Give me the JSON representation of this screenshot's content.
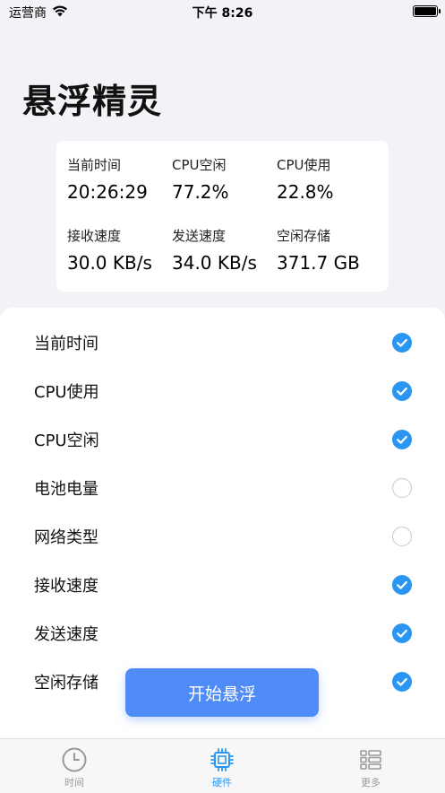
{
  "status_bar": {
    "carrier": "运营商",
    "time": "下午 8:26"
  },
  "page_title": "悬浮精灵",
  "stats": [
    {
      "label": "当前时间",
      "value": "20:26:29"
    },
    {
      "label": "CPU空闲",
      "value": "77.2%"
    },
    {
      "label": "CPU使用",
      "value": "22.8%"
    },
    {
      "label": "接收速度",
      "value": "30.0 KB/s"
    },
    {
      "label": "发送速度",
      "value": "34.0 KB/s"
    },
    {
      "label": "空闲存储",
      "value": "371.7 GB"
    }
  ],
  "options": [
    {
      "label": "当前时间",
      "checked": true
    },
    {
      "label": "CPU使用",
      "checked": true
    },
    {
      "label": "CPU空闲",
      "checked": true
    },
    {
      "label": "电池电量",
      "checked": false
    },
    {
      "label": "网络类型",
      "checked": false
    },
    {
      "label": "接收速度",
      "checked": true
    },
    {
      "label": "发送速度",
      "checked": true
    },
    {
      "label": "空闲存储",
      "checked": true
    }
  ],
  "start_button_label": "开始悬浮",
  "tabs": [
    {
      "label": "时间",
      "icon": "clock-icon",
      "active": false
    },
    {
      "label": "硬件",
      "icon": "chip-icon",
      "active": true
    },
    {
      "label": "更多",
      "icon": "list-icon",
      "active": false
    }
  ],
  "colors": {
    "accent": "#2a96f3",
    "button": "#4f8cf7",
    "background": "#f2f2f7"
  }
}
